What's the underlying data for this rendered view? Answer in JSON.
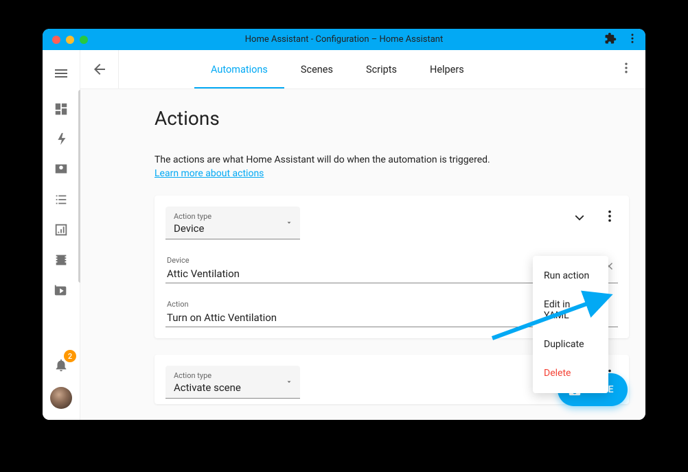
{
  "window": {
    "title": "Home Assistant - Configuration – Home Assistant"
  },
  "tabs": [
    "Automations",
    "Scenes",
    "Scripts",
    "Helpers"
  ],
  "section": {
    "title": "Actions",
    "description": "The actions are what Home Assistant will do when the automation is triggered.",
    "learn_more": "Learn more about actions"
  },
  "cards": [
    {
      "action_type_label": "Action type",
      "action_type_value": "Device",
      "device_label": "Device",
      "device_value": "Attic Ventilation",
      "action_label": "Action",
      "action_value": "Turn on Attic Ventilation"
    },
    {
      "action_type_label": "Action type",
      "action_type_value": "Activate scene"
    }
  ],
  "menu": {
    "run": "Run action",
    "yaml": "Edit in YAML",
    "duplicate": "Duplicate",
    "delete": "Delete"
  },
  "fab": {
    "label": "SAVE"
  },
  "notif": {
    "count": "2"
  }
}
